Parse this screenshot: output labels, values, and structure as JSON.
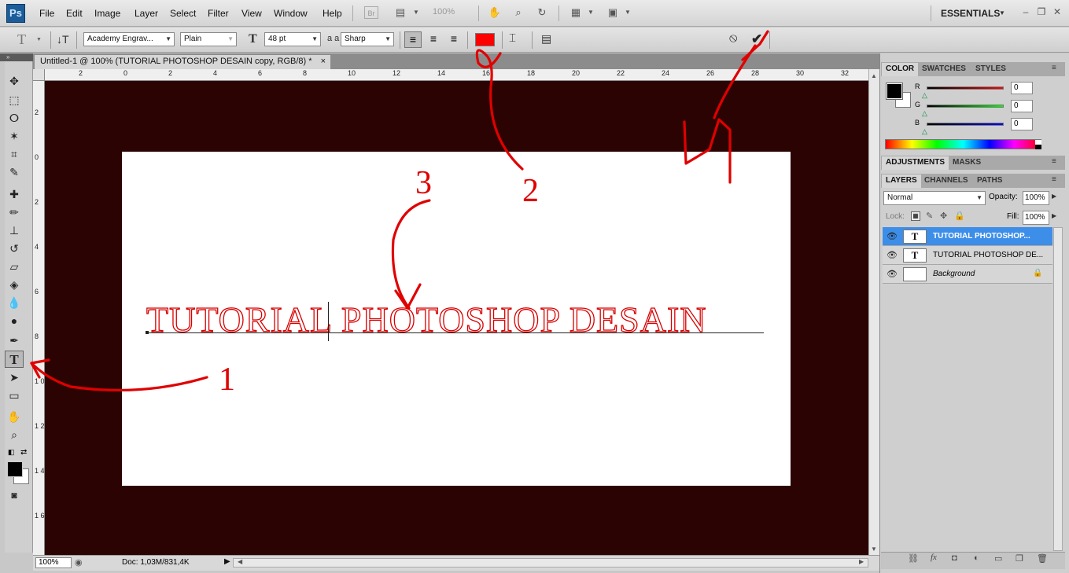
{
  "app": {
    "logo": "Ps"
  },
  "menu": [
    "File",
    "Edit",
    "Image",
    "Layer",
    "Select",
    "Filter",
    "View",
    "Window",
    "Help"
  ],
  "appbar": {
    "zoom": "100%",
    "workspace": "ESSENTIALS",
    "br_label": "Br"
  },
  "options": {
    "tool_icon": "T",
    "font_family": "Academy Engrav...",
    "font_style": "Plain",
    "font_size": "48 pt",
    "aa_label": "a a",
    "antialias": "Sharp",
    "text_color": "#ff0000"
  },
  "document": {
    "tab_title": "Untitled-1 @ 100% (TUTORIAL PHOTOSHOP DESAIN copy, RGB/8) *",
    "tab_close": "×",
    "canvas_text": "TUTORIAL PHOTOSHOP DESAIN",
    "ruler_top": [
      "2",
      "0",
      "2",
      "4",
      "6",
      "8",
      "10",
      "12",
      "14",
      "16",
      "18",
      "20",
      "22",
      "24",
      "26",
      "28",
      "30",
      "32"
    ],
    "ruler_left": [
      "2",
      "0",
      "2",
      "4",
      "6",
      "8",
      "1 0",
      "1 2",
      "1 4",
      "1 6"
    ]
  },
  "status": {
    "zoom": "100%",
    "doc": "Doc: 1,03M/831,4K"
  },
  "panels": {
    "color_tabs": [
      "COLOR",
      "SWATCHES",
      "STYLES"
    ],
    "channels": [
      {
        "label": "R",
        "value": "0",
        "gradient": "linear-gradient(90deg,#000,#ff0000)"
      },
      {
        "label": "G",
        "value": "0",
        "gradient": "linear-gradient(90deg,#000,#00ff00)"
      },
      {
        "label": "B",
        "value": "0",
        "gradient": "linear-gradient(90deg,#000,#0000ff)"
      }
    ],
    "adjust_tabs": [
      "ADJUSTMENTS",
      "MASKS"
    ],
    "layer_tabs": [
      "LAYERS",
      "CHANNELS",
      "PATHS"
    ],
    "blend_mode": "Normal",
    "opacity_label": "Opacity:",
    "opacity": "100%",
    "lock_label": "Lock:",
    "fill_label": "Fill:",
    "fill": "100%",
    "layers": [
      {
        "name": "TUTORIAL PHOTOSHOP...",
        "thumb": "T",
        "selected": true
      },
      {
        "name": "TUTORIAL PHOTOSHOP DE...",
        "thumb": "T",
        "selected": false
      },
      {
        "name": "Background",
        "thumb": "",
        "selected": false,
        "locked": true
      }
    ]
  },
  "annotations": {
    "marks": [
      "1",
      "2",
      "3",
      "4"
    ],
    "color": "#e00000"
  }
}
